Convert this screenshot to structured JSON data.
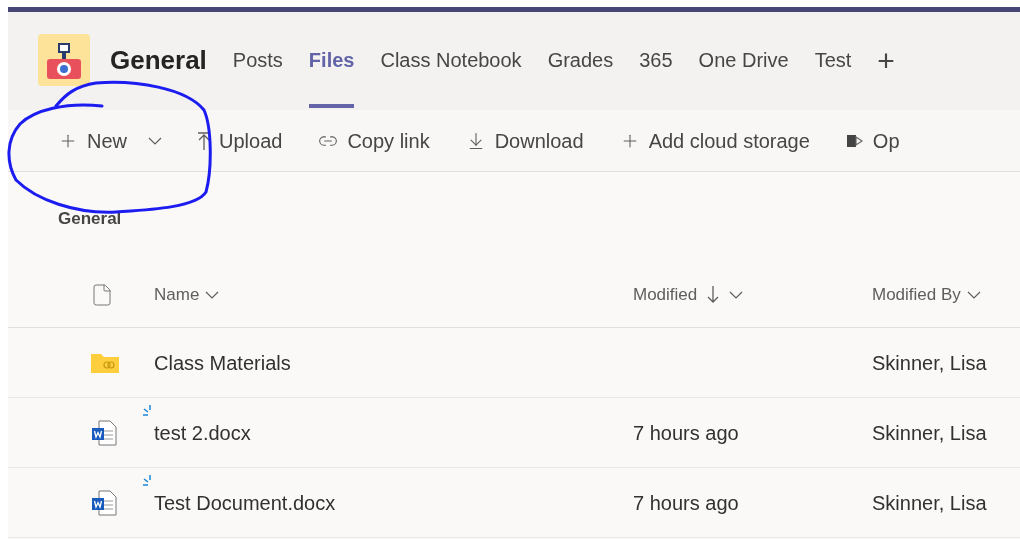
{
  "channel": {
    "title": "General"
  },
  "tabs": [
    {
      "label": "Posts",
      "selected": false
    },
    {
      "label": "Files",
      "selected": true
    },
    {
      "label": "Class Notebook",
      "selected": false
    },
    {
      "label": "Grades",
      "selected": false
    },
    {
      "label": "365",
      "selected": false
    },
    {
      "label": "One Drive",
      "selected": false
    },
    {
      "label": "Test",
      "selected": false
    }
  ],
  "add_tab": {
    "label": "+"
  },
  "toolbar": [
    {
      "label": "New",
      "kind": "new"
    },
    {
      "label": "Upload",
      "kind": "upload"
    },
    {
      "label": "Copy link",
      "kind": "link"
    },
    {
      "label": "Download",
      "kind": "download"
    },
    {
      "label": "Add cloud storage",
      "kind": "add"
    },
    {
      "label": "Op",
      "kind": "sharepoint"
    }
  ],
  "annotation": {
    "kind": "circle"
  },
  "breadcrumb": "General",
  "table": {
    "columns": [
      {
        "label": "Name",
        "sorted": false
      },
      {
        "label": "Modified",
        "sorted": true
      },
      {
        "label": "Modified By",
        "sorted": false
      }
    ],
    "rows": [
      {
        "kind": "folder",
        "name": "Class Materials",
        "new": false,
        "modified_by": "Skinner, Lisa"
      },
      {
        "kind": "word",
        "name": "test 2.docx",
        "new": true,
        "modified": "7 hours ago",
        "modified_by": "Skinner, Lisa"
      },
      {
        "kind": "word",
        "name": "Test Document.docx",
        "new": true,
        "modified": "7 hours ago",
        "modified_by": "Skinner, Lisa"
      }
    ]
  }
}
